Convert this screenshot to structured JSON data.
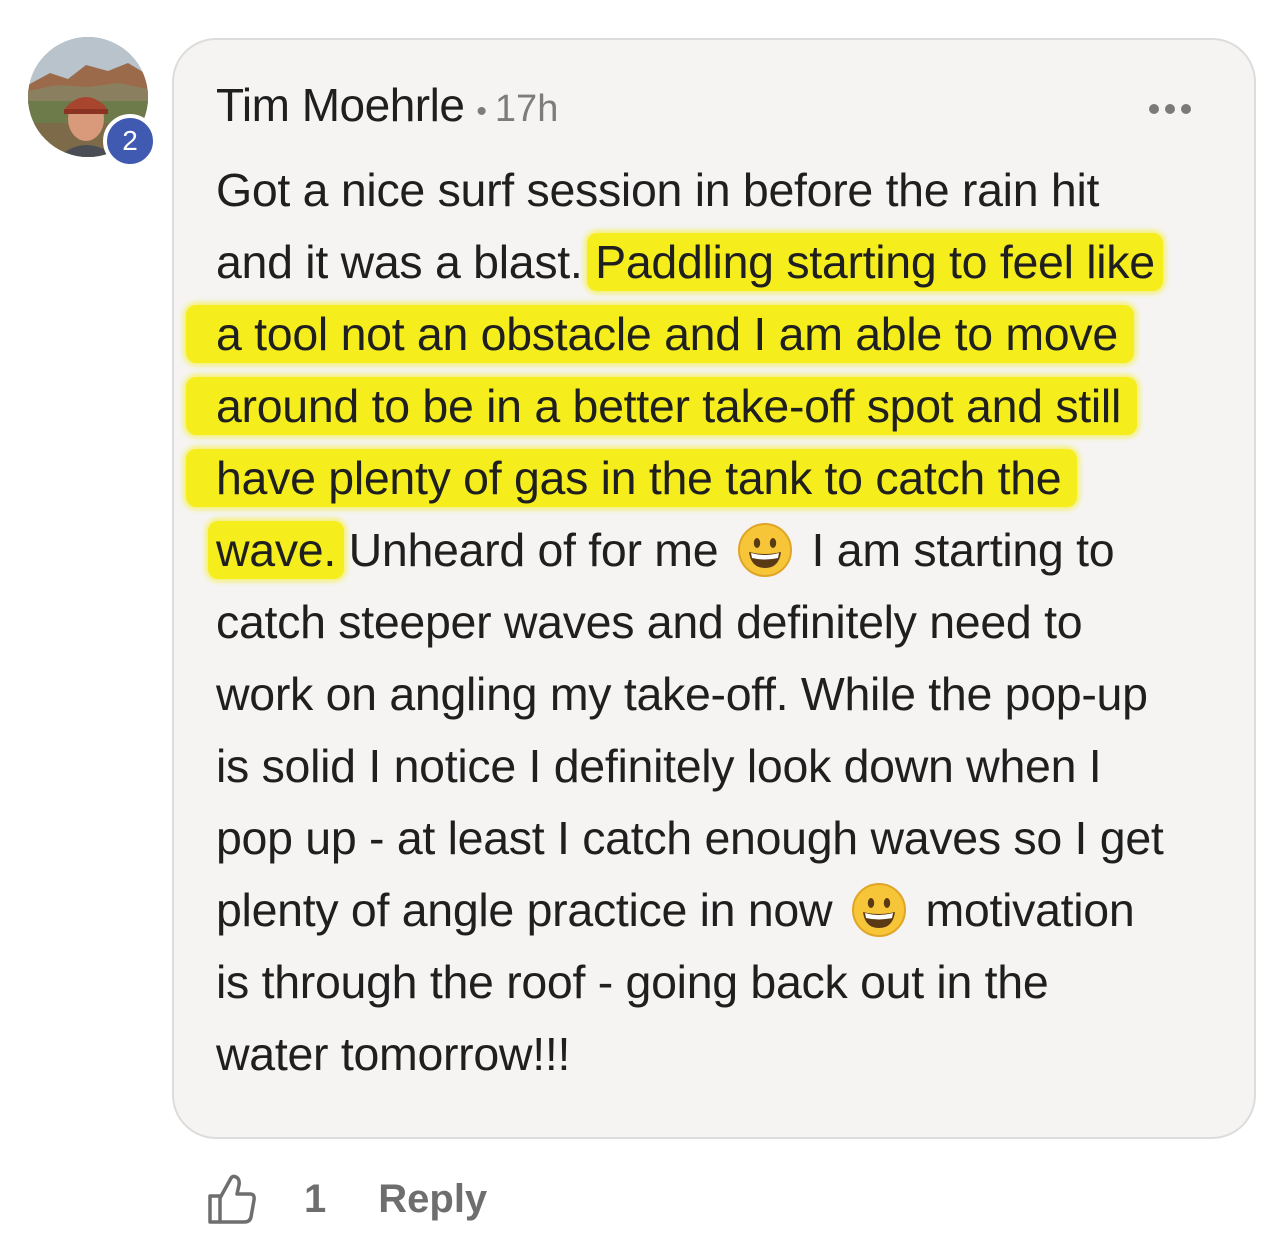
{
  "comment": {
    "author": "Tim Moehrle",
    "separator": "•",
    "time": "17h",
    "avatar_badge": "2",
    "more_icon": "more-horizontal-icon",
    "highlight_color": "#f5ee1c",
    "lines": [
      {
        "a": "Got a nice surf session in before the rain hit"
      },
      {
        "a": "and it was a blast. ",
        "h": "Paddling starting to feel like"
      },
      {
        "h": "a tool not an obstacle and I am able to move"
      },
      {
        "h": "around to be in a better take-off spot and still"
      },
      {
        "h": "have plenty of gas in the tank to catch the"
      },
      {
        "h": "wave.",
        "b": " Unheard of for me ",
        "c": " I am starting to"
      },
      {
        "a": "catch steeper waves and definitely need to"
      },
      {
        "a": "work on angling my take-off. While the pop-up"
      },
      {
        "a": "is solid I notice I definitely look down when I"
      },
      {
        "a": "pop up - at least I catch enough waves so I get"
      },
      {
        "a": "plenty of angle practice in now ",
        "c": " motivation"
      },
      {
        "a": "is through the roof - going back out in the"
      },
      {
        "a": "water tomorrow!!!"
      }
    ]
  },
  "actions": {
    "like_icon": "thumbs-up-icon",
    "like_count": "1",
    "reply_label": "Reply"
  }
}
